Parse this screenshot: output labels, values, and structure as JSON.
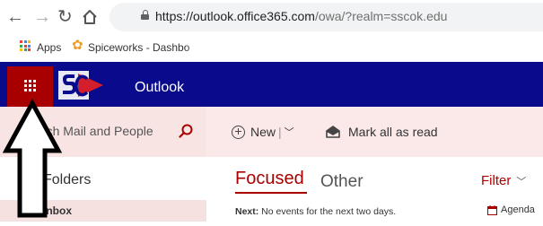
{
  "browser": {
    "url_host": "https://outlook.office365.com",
    "url_path": "/owa/?realm=sscok.edu"
  },
  "bookmarks": {
    "apps_label": "Apps",
    "spiceworks_label": "Spiceworks - Dashbo"
  },
  "app": {
    "title": "Outlook",
    "brand_color": "#0a0b8c",
    "accent_color": "#a80000"
  },
  "toolbar": {
    "search_placeholder": "Search Mail and People",
    "new_label": "New",
    "mark_all_read_label": "Mark all as read"
  },
  "folders": {
    "header": "Folders",
    "items": [
      {
        "label": "Inbox"
      }
    ]
  },
  "message_list": {
    "tabs": [
      {
        "label": "Focused"
      },
      {
        "label": "Other"
      }
    ],
    "filter_label": "Filter",
    "next_prefix": "Next:",
    "next_text": " No events for the next two days.",
    "agenda_label": "Agenda"
  }
}
